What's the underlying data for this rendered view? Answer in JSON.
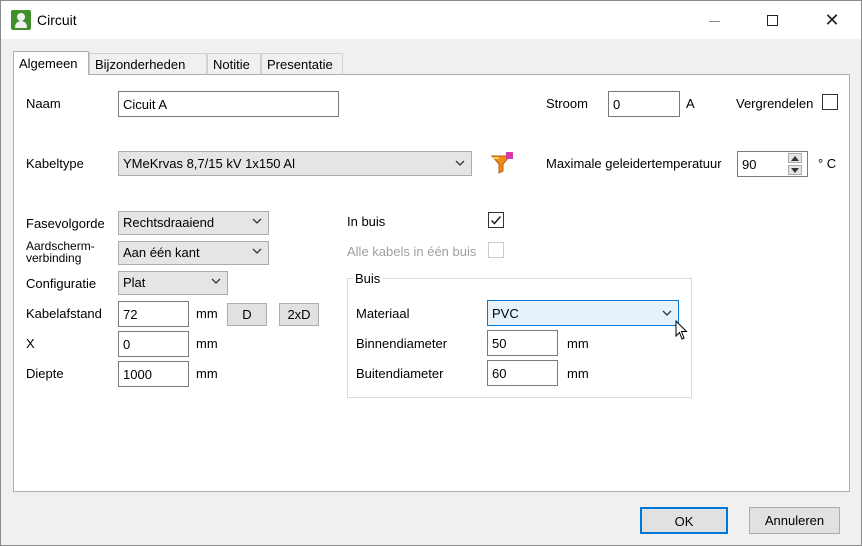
{
  "window": {
    "title": "Circuit"
  },
  "tabs": [
    {
      "label": "Algemeen",
      "active": true
    },
    {
      "label": "Bijzonderheden",
      "active": false
    },
    {
      "label": "Notitie",
      "active": false
    },
    {
      "label": "Presentatie",
      "active": false
    }
  ],
  "form": {
    "naam": {
      "label": "Naam",
      "value": "Cicuit A"
    },
    "stroom": {
      "label": "Stroom",
      "value": "0",
      "unit": "A"
    },
    "vergrendelen": {
      "label": "Vergrendelen",
      "checked": false
    },
    "kabeltype": {
      "label": "Kabeltype",
      "value": "YMeKrvas 8,7/15 kV  1x150 Al"
    },
    "max_temp": {
      "label": "Maximale geleidertemperatuur",
      "value": "90",
      "unit": "° C"
    },
    "fasevolgorde": {
      "label": "Fasevolgorde",
      "value": "Rechtsdraaiend"
    },
    "aardscherm": {
      "label_line1": "Aardscherm-",
      "label_line2": "verbinding",
      "value": "Aan één kant"
    },
    "configuratie": {
      "label": "Configuratie",
      "value": "Plat"
    },
    "kabelafstand": {
      "label": "Kabelafstand",
      "value": "72",
      "unit": "mm",
      "btn_d": "D",
      "btn_2xd": "2xD"
    },
    "x": {
      "label": "X",
      "value": "0",
      "unit": "mm"
    },
    "diepte": {
      "label": "Diepte",
      "value": "1000",
      "unit": "mm"
    },
    "in_buis": {
      "label": "In buis",
      "checked": true
    },
    "alle_kabels": {
      "label": "Alle kabels in één buis",
      "checked": false,
      "disabled": true
    }
  },
  "buis": {
    "title": "Buis",
    "materiaal": {
      "label": "Materiaal",
      "value": "PVC"
    },
    "binnendiameter": {
      "label": "Binnendiameter",
      "value": "50",
      "unit": "mm"
    },
    "buitendiameter": {
      "label": "Buitendiameter",
      "value": "60",
      "unit": "mm"
    }
  },
  "footer": {
    "ok": "OK",
    "cancel": "Annuleren"
  },
  "colors": {
    "accent": "#0078d7",
    "focus_bg": "#e5f1fb",
    "button_bg": "#e1e1e1",
    "combo_bg": "#e5e5e5"
  }
}
